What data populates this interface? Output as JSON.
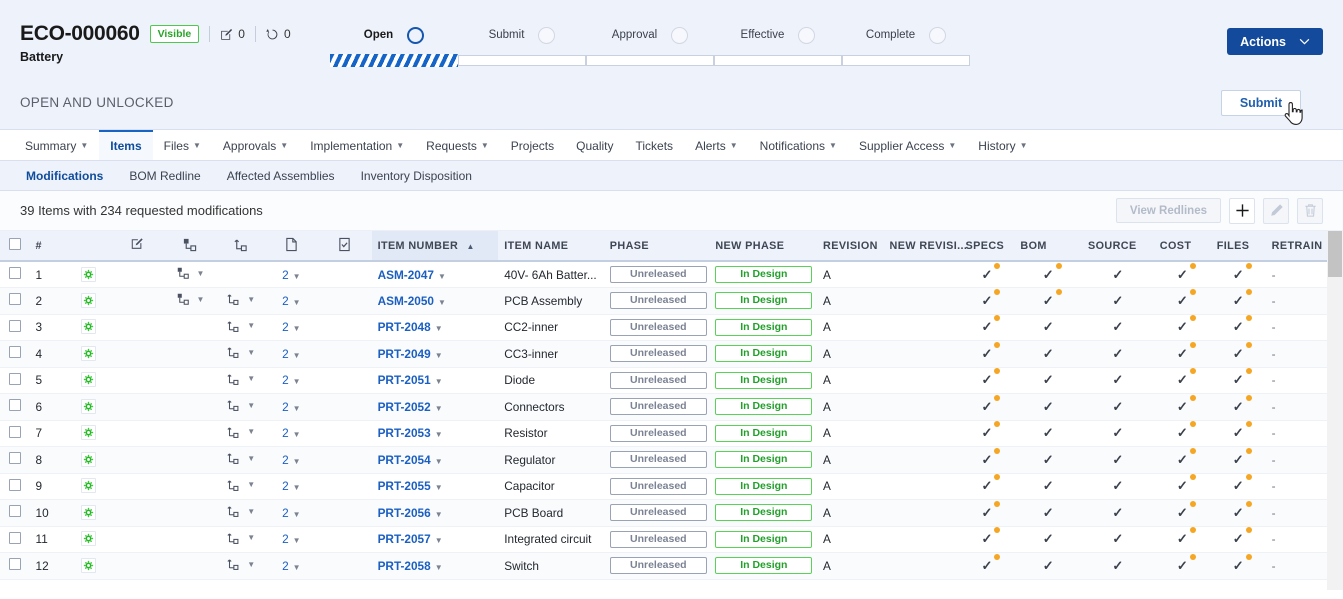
{
  "header": {
    "eco_id": "ECO-000060",
    "visible_badge": "Visible",
    "edit_count": "0",
    "sync_count": "0",
    "subtitle": "Battery",
    "status_text": "OPEN AND UNLOCKED",
    "actions_label": "Actions",
    "submit_label": "Submit",
    "accent_blue": "#134a9b",
    "green": "#4ec94e"
  },
  "stepper": {
    "steps": [
      {
        "label": "Open",
        "active": true
      },
      {
        "label": "Submit",
        "active": false
      },
      {
        "label": "Approval",
        "active": false
      },
      {
        "label": "Effective",
        "active": false
      },
      {
        "label": "Complete",
        "active": false
      }
    ]
  },
  "nav": {
    "tabs": [
      {
        "label": "Summary",
        "caret": true,
        "active": false
      },
      {
        "label": "Items",
        "caret": false,
        "active": true
      },
      {
        "label": "Files",
        "caret": true,
        "active": false
      },
      {
        "label": "Approvals",
        "caret": true,
        "active": false
      },
      {
        "label": "Implementation",
        "caret": true,
        "active": false
      },
      {
        "label": "Requests",
        "caret": true,
        "active": false
      },
      {
        "label": "Projects",
        "caret": false,
        "active": false
      },
      {
        "label": "Quality",
        "caret": false,
        "active": false
      },
      {
        "label": "Tickets",
        "caret": false,
        "active": false
      },
      {
        "label": "Alerts",
        "caret": true,
        "active": false
      },
      {
        "label": "Notifications",
        "caret": true,
        "active": false
      },
      {
        "label": "Supplier Access",
        "caret": true,
        "active": false
      },
      {
        "label": "History",
        "caret": true,
        "active": false
      }
    ]
  },
  "subnav": {
    "tabs": [
      {
        "label": "Modifications",
        "active": true
      },
      {
        "label": "BOM Redline",
        "active": false
      },
      {
        "label": "Affected Assemblies",
        "active": false
      },
      {
        "label": "Inventory Disposition",
        "active": false
      }
    ]
  },
  "toolbar": {
    "summary_text": "39 Items with 234 requested modifications",
    "view_redlines_label": "View Redlines",
    "add_label": "+",
    "edit_label": "edit-icon",
    "delete_label": "trash-icon"
  },
  "table": {
    "columns": [
      {
        "key": "select",
        "label": ""
      },
      {
        "key": "num",
        "label": "#"
      },
      {
        "key": "status",
        "label": ""
      },
      {
        "key": "modify",
        "label": "edit-square-icon"
      },
      {
        "key": "child",
        "label": "child-hierarchy-icon"
      },
      {
        "key": "parent",
        "label": "parent-hierarchy-icon"
      },
      {
        "key": "file",
        "label": "file-icon"
      },
      {
        "key": "checklist",
        "label": "checklist-icon"
      },
      {
        "key": "item_number",
        "label": "ITEM NUMBER"
      },
      {
        "key": "item_name",
        "label": "ITEM NAME"
      },
      {
        "key": "phase",
        "label": "PHASE"
      },
      {
        "key": "new_phase",
        "label": "NEW PHASE"
      },
      {
        "key": "revision",
        "label": "REVISION"
      },
      {
        "key": "new_revision",
        "label": "NEW REVISI..."
      },
      {
        "key": "specs",
        "label": "SPECS"
      },
      {
        "key": "bom",
        "label": "BOM"
      },
      {
        "key": "source",
        "label": "SOURCE"
      },
      {
        "key": "cost",
        "label": "COST"
      },
      {
        "key": "files",
        "label": "FILES"
      },
      {
        "key": "retrain",
        "label": "RETRAIN"
      }
    ],
    "sort_column": "ITEM NUMBER",
    "sort_direction": "asc",
    "rows": [
      {
        "num": "1",
        "child": true,
        "parent": false,
        "qty": "2",
        "item_number": "ASM-2047",
        "item_name": "40V- 6Ah Batter...",
        "phase": "Unreleased",
        "new_phase": "In Design",
        "revision": "A",
        "new_revision": "",
        "specs": true,
        "specs_dot": true,
        "bom": true,
        "bom_dot": true,
        "source": true,
        "source_dot": false,
        "cost": true,
        "cost_dot": true,
        "files": true,
        "files_dot": true,
        "retrain": "-"
      },
      {
        "num": "2",
        "child": true,
        "parent": true,
        "qty": "2",
        "item_number": "ASM-2050",
        "item_name": "PCB Assembly",
        "phase": "Unreleased",
        "new_phase": "In Design",
        "revision": "A",
        "new_revision": "",
        "specs": true,
        "specs_dot": true,
        "bom": true,
        "bom_dot": true,
        "source": true,
        "source_dot": false,
        "cost": true,
        "cost_dot": true,
        "files": true,
        "files_dot": true,
        "retrain": "-"
      },
      {
        "num": "3",
        "child": false,
        "parent": true,
        "qty": "2",
        "item_number": "PRT-2048",
        "item_name": "CC2-inner",
        "phase": "Unreleased",
        "new_phase": "In Design",
        "revision": "A",
        "new_revision": "",
        "specs": true,
        "specs_dot": true,
        "bom": true,
        "bom_dot": false,
        "source": true,
        "source_dot": false,
        "cost": true,
        "cost_dot": true,
        "files": true,
        "files_dot": true,
        "retrain": "-"
      },
      {
        "num": "4",
        "child": false,
        "parent": true,
        "qty": "2",
        "item_number": "PRT-2049",
        "item_name": "CC3-inner",
        "phase": "Unreleased",
        "new_phase": "In Design",
        "revision": "A",
        "new_revision": "",
        "specs": true,
        "specs_dot": true,
        "bom": true,
        "bom_dot": false,
        "source": true,
        "source_dot": false,
        "cost": true,
        "cost_dot": true,
        "files": true,
        "files_dot": true,
        "retrain": "-"
      },
      {
        "num": "5",
        "child": false,
        "parent": true,
        "qty": "2",
        "item_number": "PRT-2051",
        "item_name": "Diode",
        "phase": "Unreleased",
        "new_phase": "In Design",
        "revision": "A",
        "new_revision": "",
        "specs": true,
        "specs_dot": true,
        "bom": true,
        "bom_dot": false,
        "source": true,
        "source_dot": false,
        "cost": true,
        "cost_dot": true,
        "files": true,
        "files_dot": true,
        "retrain": "-"
      },
      {
        "num": "6",
        "child": false,
        "parent": true,
        "qty": "2",
        "item_number": "PRT-2052",
        "item_name": "Connectors",
        "phase": "Unreleased",
        "new_phase": "In Design",
        "revision": "A",
        "new_revision": "",
        "specs": true,
        "specs_dot": true,
        "bom": true,
        "bom_dot": false,
        "source": true,
        "source_dot": false,
        "cost": true,
        "cost_dot": true,
        "files": true,
        "files_dot": true,
        "retrain": "-"
      },
      {
        "num": "7",
        "child": false,
        "parent": true,
        "qty": "2",
        "item_number": "PRT-2053",
        "item_name": "Resistor",
        "phase": "Unreleased",
        "new_phase": "In Design",
        "revision": "A",
        "new_revision": "",
        "specs": true,
        "specs_dot": true,
        "bom": true,
        "bom_dot": false,
        "source": true,
        "source_dot": false,
        "cost": true,
        "cost_dot": true,
        "files": true,
        "files_dot": true,
        "retrain": "-"
      },
      {
        "num": "8",
        "child": false,
        "parent": true,
        "qty": "2",
        "item_number": "PRT-2054",
        "item_name": "Regulator",
        "phase": "Unreleased",
        "new_phase": "In Design",
        "revision": "A",
        "new_revision": "",
        "specs": true,
        "specs_dot": true,
        "bom": true,
        "bom_dot": false,
        "source": true,
        "source_dot": false,
        "cost": true,
        "cost_dot": true,
        "files": true,
        "files_dot": true,
        "retrain": "-"
      },
      {
        "num": "9",
        "child": false,
        "parent": true,
        "qty": "2",
        "item_number": "PRT-2055",
        "item_name": "Capacitor",
        "phase": "Unreleased",
        "new_phase": "In Design",
        "revision": "A",
        "new_revision": "",
        "specs": true,
        "specs_dot": true,
        "bom": true,
        "bom_dot": false,
        "source": true,
        "source_dot": false,
        "cost": true,
        "cost_dot": true,
        "files": true,
        "files_dot": true,
        "retrain": "-"
      },
      {
        "num": "10",
        "child": false,
        "parent": true,
        "qty": "2",
        "item_number": "PRT-2056",
        "item_name": "PCB Board",
        "phase": "Unreleased",
        "new_phase": "In Design",
        "revision": "A",
        "new_revision": "",
        "specs": true,
        "specs_dot": true,
        "bom": true,
        "bom_dot": false,
        "source": true,
        "source_dot": false,
        "cost": true,
        "cost_dot": true,
        "files": true,
        "files_dot": true,
        "retrain": "-"
      },
      {
        "num": "11",
        "child": false,
        "parent": true,
        "qty": "2",
        "item_number": "PRT-2057",
        "item_name": "Integrated circuit",
        "phase": "Unreleased",
        "new_phase": "In Design",
        "revision": "A",
        "new_revision": "",
        "specs": true,
        "specs_dot": true,
        "bom": true,
        "bom_dot": false,
        "source": true,
        "source_dot": false,
        "cost": true,
        "cost_dot": true,
        "files": true,
        "files_dot": true,
        "retrain": "-"
      },
      {
        "num": "12",
        "child": false,
        "parent": true,
        "qty": "2",
        "item_number": "PRT-2058",
        "item_name": "Switch",
        "phase": "Unreleased",
        "new_phase": "In Design",
        "revision": "A",
        "new_revision": "",
        "specs": true,
        "specs_dot": true,
        "bom": true,
        "bom_dot": false,
        "source": true,
        "source_dot": false,
        "cost": true,
        "cost_dot": true,
        "files": true,
        "files_dot": true,
        "retrain": "-"
      }
    ]
  }
}
